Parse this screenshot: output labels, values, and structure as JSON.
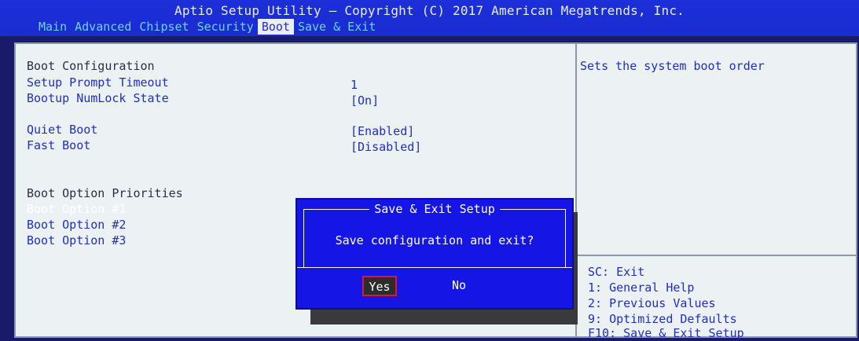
{
  "header": {
    "title": "Aptio Setup Utility – Copyright (C) 2017 American Megatrends, Inc.",
    "tabs": [
      "Main",
      "Advanced",
      "Chipset",
      "Security",
      "Boot",
      "Save & Exit"
    ],
    "active_tab": "Boot"
  },
  "settings": {
    "boot_configuration": "Boot Configuration",
    "setup_prompt_timeout": {
      "label": "Setup Prompt Timeout",
      "value": "1"
    },
    "bootup_numlock_state": {
      "label": "Bootup NumLock State",
      "value": "[On]"
    },
    "quiet_boot": {
      "label": "Quiet Boot",
      "value": "[Enabled]"
    },
    "fast_boot": {
      "label": "Fast Boot",
      "value": "[Disabled]"
    },
    "boot_option_priorities": "Boot Option Priorities",
    "boot_option_1": "Boot Option #1",
    "boot_option_2": "Boot Option #2",
    "boot_option_3": "Boot Option #3"
  },
  "help_panel": {
    "text": "Sets the system boot order"
  },
  "keys_panel": {
    "lines": [
      "SC: Exit",
      "1: General Help",
      "2: Previous Values",
      "9: Optimized Defaults",
      "F10: Save & Exit Setup"
    ]
  },
  "dialog": {
    "title": "Save & Exit Setup",
    "message": "Save configuration and exit?",
    "yes_label": "Yes",
    "no_label": "No"
  },
  "colors": {
    "header_blue": "#1c2fd8",
    "tab_text": "#6cd4f2",
    "item_text": "#1f2fc4",
    "panel_bg": "#ecf1f3",
    "dialog_bg": "#1515e6",
    "selected_button_border": "#d81a2a"
  }
}
